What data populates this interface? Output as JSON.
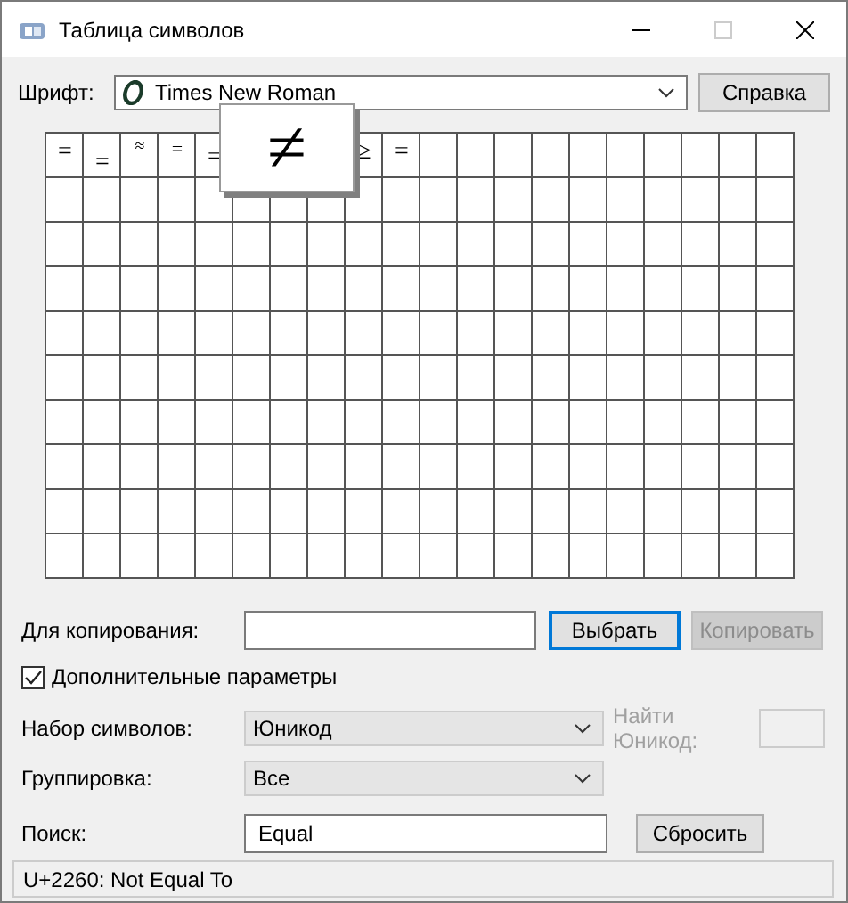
{
  "window": {
    "title": "Таблица символов"
  },
  "font": {
    "label": "Шрифт:",
    "value": "Times New Roman",
    "help_button": "Справка"
  },
  "grid": {
    "cells_before_popup": [
      "=",
      "=",
      "≈",
      "=",
      "="
    ],
    "cells_after_popup": [
      "≥",
      "="
    ],
    "magnified": "≠"
  },
  "copy": {
    "label": "Для копирования:",
    "select_button": "Выбрать",
    "copy_button": {
      "label": "Копировать",
      "disabled": true
    }
  },
  "advanced": {
    "label": "Дополнительные параметры",
    "checked": true
  },
  "charset": {
    "label": "Набор символов:",
    "value": "Юникод",
    "find_label": "Найти Юникод:",
    "find_disabled": true
  },
  "grouping": {
    "label": "Группировка:",
    "value": "Все"
  },
  "search": {
    "label": "Поиск:",
    "value": "Equal",
    "reset_button": "Сбросить"
  },
  "status_bar": "U+2260: Not Equal To"
}
